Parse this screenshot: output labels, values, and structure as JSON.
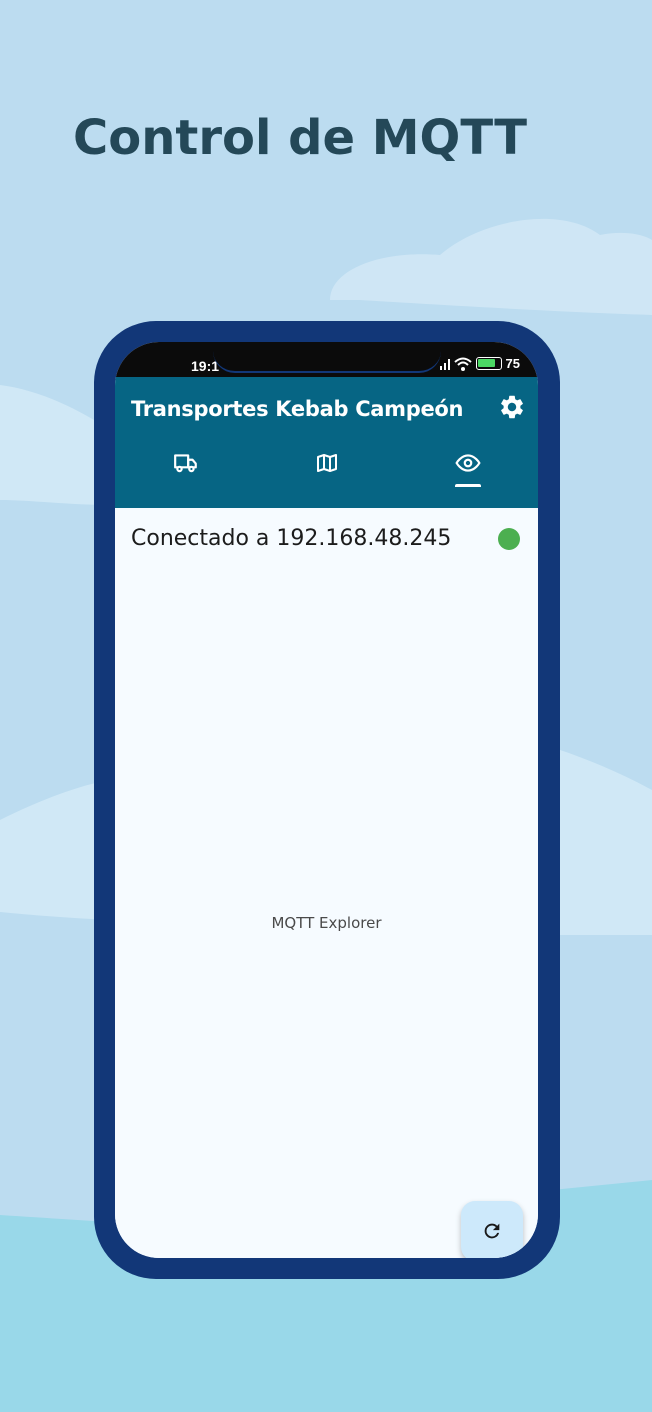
{
  "promo": {
    "headline": "Control de MQTT"
  },
  "status_bar": {
    "time": "19:1",
    "battery_text": "75"
  },
  "app_bar": {
    "title": "Transportes Kebab Campeón",
    "settings_icon": "gear-icon",
    "tabs": [
      {
        "icon": "truck-icon",
        "selected": false
      },
      {
        "icon": "map-icon",
        "selected": false
      },
      {
        "icon": "eye-icon",
        "selected": true
      }
    ]
  },
  "connection": {
    "text": "Conectado a 192.168.48.245",
    "status_color": "#4caf50"
  },
  "main": {
    "placeholder_label": "MQTT Explorer"
  },
  "fab": {
    "icon": "refresh-icon"
  },
  "colors": {
    "background": "#bcdcf0",
    "frame": "#123778",
    "app_bar": "#066584",
    "headline": "#244858",
    "fab": "#cde9fb"
  }
}
